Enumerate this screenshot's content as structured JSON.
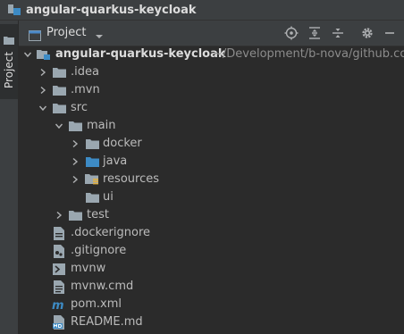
{
  "window": {
    "title": "angular-quarkus-keycloak"
  },
  "sidebar": {
    "tab_label": "Project"
  },
  "panel": {
    "view_label": "Project",
    "icons": [
      "crosshair-icon",
      "expand-all-icon",
      "collapse-all-icon",
      "gear-icon",
      "minimize-icon"
    ]
  },
  "tree": {
    "root": {
      "label": "angular-quarkus-keycloak",
      "path": "~/Development/b-nova/github.com/"
    },
    "items": [
      {
        "label": ".idea",
        "icon": "folder-icon"
      },
      {
        "label": ".mvn",
        "icon": "folder-icon"
      },
      {
        "label": "src",
        "icon": "folder-icon"
      },
      {
        "label": "main",
        "icon": "folder-icon"
      },
      {
        "label": "docker",
        "icon": "folder-icon"
      },
      {
        "label": "java",
        "icon": "source-folder-icon"
      },
      {
        "label": "resources",
        "icon": "resources-folder-icon"
      },
      {
        "label": "ui",
        "icon": "folder-icon"
      },
      {
        "label": "test",
        "icon": "folder-icon"
      },
      {
        "label": ".dockerignore",
        "icon": "ignore-file-icon"
      },
      {
        "label": ".gitignore",
        "icon": "ignore-file-icon"
      },
      {
        "label": "mvnw",
        "icon": "script-file-icon"
      },
      {
        "label": "mvnw.cmd",
        "icon": "text-file-icon"
      },
      {
        "label": "pom.xml",
        "icon": "maven-icon"
      },
      {
        "label": "README.md",
        "icon": "markdown-file-icon"
      }
    ]
  },
  "colors": {
    "background": "#2b2b2b",
    "header": "#3c3f41",
    "folder": "#9aa7b0",
    "source_folder": "#3d8bc5",
    "text": "#bbbbbb"
  }
}
